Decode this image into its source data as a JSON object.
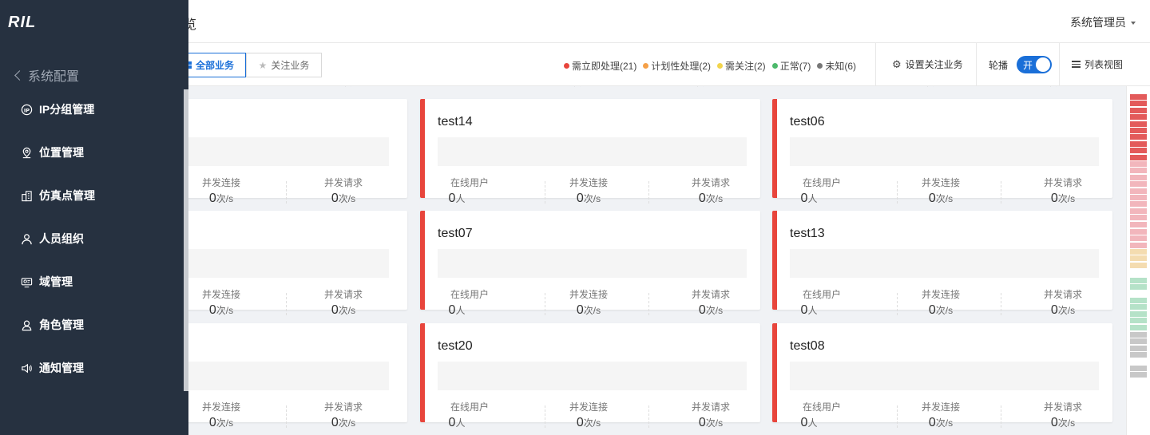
{
  "app": {
    "logo": "RIL",
    "title_fragment": "览",
    "user": "系统管理员"
  },
  "sidebar": {
    "back_label": "系统配置",
    "items": [
      {
        "label": "IP分组管理",
        "icon": "ip-icon"
      },
      {
        "label": "位置管理",
        "icon": "location-pin-icon"
      },
      {
        "label": "仿真点管理",
        "icon": "building-icon"
      },
      {
        "label": "人员组织",
        "icon": "user-icon"
      },
      {
        "label": "域管理",
        "icon": "domain-icon"
      },
      {
        "label": "角色管理",
        "icon": "role-icon"
      },
      {
        "label": "通知管理",
        "icon": "speaker-icon"
      }
    ]
  },
  "toolbar": {
    "tab_all": "全部业务",
    "tab_fav": "关注业务",
    "legend": [
      {
        "label": "需立即处理(21)",
        "color": "#e8453c"
      },
      {
        "label": "计划性处理(2)",
        "color": "#f5a048"
      },
      {
        "label": "需关注(2)",
        "color": "#f2d44c"
      },
      {
        "label": "正常(7)",
        "color": "#4cb96b"
      },
      {
        "label": "未知(6)",
        "color": "#777777"
      }
    ],
    "settings_label": "设置关注业务",
    "carousel_label": "轮播",
    "toggle_label": "开",
    "list_view_label": "列表视图"
  },
  "stats": {
    "online_users": "在线用户",
    "concurrent_conn": "并发连接",
    "concurrent_req": "并发请求",
    "value": "0",
    "unit_person": "人",
    "unit_rate": "次/s"
  },
  "cards": {
    "col1_r1": "",
    "col1_r2": "",
    "col1_r3": "",
    "col2_r1": "test14",
    "col2_r2": "test07",
    "col2_r3": "test20",
    "col3_r1": "test06",
    "col3_r2": "test13",
    "col3_r3": "test08"
  },
  "colors": {
    "accent": "#1a6fd8",
    "sidebar_bg": "#263140",
    "critical": "#e8453c"
  }
}
